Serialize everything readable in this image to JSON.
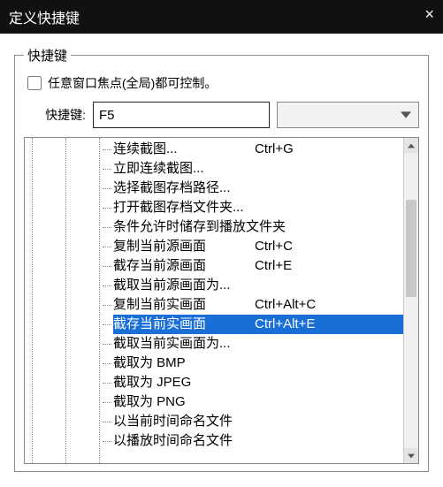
{
  "window": {
    "title": "定义快捷键",
    "close_glyph": "×"
  },
  "group": {
    "legend": "快捷键",
    "checkbox_label": "任意窗口焦点(全局)都可控制。",
    "key_label": "快捷键:",
    "key_value": "F5"
  },
  "tree": {
    "items": [
      {
        "label": "连续截图...",
        "shortcut": "Ctrl+G",
        "selected": false
      },
      {
        "label": "立即连续截图...",
        "shortcut": "",
        "selected": false
      },
      {
        "label": "选择截图存档路径...",
        "shortcut": "",
        "selected": false
      },
      {
        "label": "打开截图存档文件夹...",
        "shortcut": "",
        "selected": false
      },
      {
        "label": "条件允许时储存到播放文件夹",
        "shortcut": "",
        "selected": false
      },
      {
        "label": "复制当前源画面",
        "shortcut": "Ctrl+C",
        "selected": false
      },
      {
        "label": "截存当前源画面",
        "shortcut": "Ctrl+E",
        "selected": false
      },
      {
        "label": "截取当前源画面为...",
        "shortcut": "",
        "selected": false
      },
      {
        "label": "复制当前实画面",
        "shortcut": "Ctrl+Alt+C",
        "selected": false
      },
      {
        "label": "截存当前实画面",
        "shortcut": "Ctrl+Alt+E",
        "selected": true
      },
      {
        "label": "截取当前实画面为...",
        "shortcut": "",
        "selected": false
      },
      {
        "label": "截取为 BMP",
        "shortcut": "",
        "selected": false
      },
      {
        "label": "截取为 JPEG",
        "shortcut": "",
        "selected": false
      },
      {
        "label": "截取为 PNG",
        "shortcut": "",
        "selected": false
      },
      {
        "label": "以当前时间命名文件",
        "shortcut": "",
        "selected": false
      },
      {
        "label": "以播放时间命名文件",
        "shortcut": "",
        "selected": false
      }
    ]
  }
}
